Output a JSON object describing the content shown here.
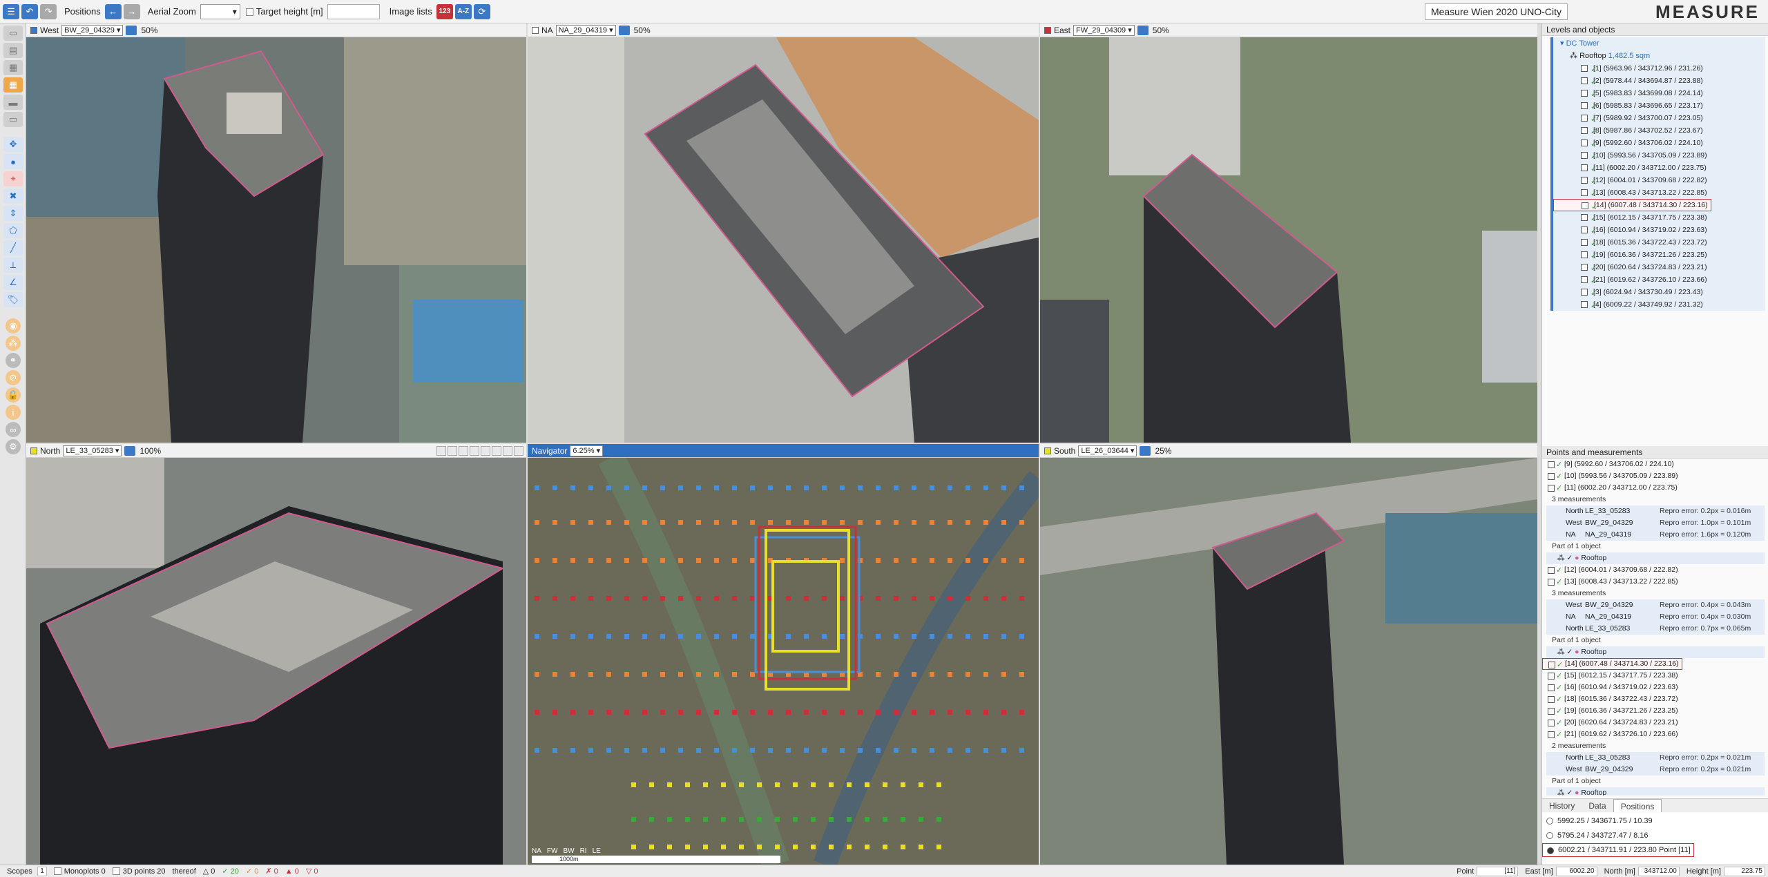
{
  "toolbar": {
    "positions_label": "Positions",
    "aerial_zoom_label": "Aerial Zoom",
    "target_height_label": "Target height [m]",
    "image_lists_label": "Image lists",
    "sort_numeric": "123",
    "sort_alpha": "A-Z",
    "app_title": "Measure Wien 2020 UNO-City",
    "brand": "MEASURE"
  },
  "views": {
    "west": {
      "label": "West",
      "image": "BW_29_04329",
      "zoom": "50%"
    },
    "na": {
      "label": "NA",
      "image": "NA_29_04319",
      "zoom": "50%"
    },
    "east": {
      "label": "East",
      "image": "FW_29_04309",
      "zoom": "50%"
    },
    "north": {
      "label": "North",
      "image": "LE_33_05283",
      "zoom": "100%"
    },
    "navigator": {
      "label": "Navigator",
      "zoom": "6.25%",
      "scale": "1000m",
      "legend": [
        "NA",
        "FW",
        "BW",
        "RI",
        "LE"
      ]
    },
    "south": {
      "label": "South",
      "image": "LE_26_03644",
      "zoom": "25%"
    }
  },
  "colors": {
    "accent": "#3b79c6",
    "selected": "#c8303a",
    "nav_orange": "#e8843a",
    "nav_blue": "#4a8fd6",
    "nav_red": "#c8303a",
    "nav_yellow": "#e6e02a",
    "nav_green": "#3aa83a"
  },
  "levels": {
    "title": "Levels and objects",
    "tower": "DC Tower",
    "rooftop": "Rooftop",
    "rooftop_area": "1,482.5 sqm",
    "points": [
      "[1] (5963.96 / 343712.96 / 231.26)",
      "[2] (5978.44 / 343694.87 / 223.88)",
      "[5] (5983.83 / 343699.08 / 224.14)",
      "[6] (5985.83 / 343696.65 / 223.17)",
      "[7] (5989.92 / 343700.07 / 223.05)",
      "[8] (5987.86 / 343702.52 / 223.67)",
      "[9] (5992.60 / 343706.02 / 224.10)",
      "[10] (5993.56 / 343705.09 / 223.89)",
      "[11] (6002.20 / 343712.00 / 223.75)",
      "[12] (6004.01 / 343709.68 / 222.82)",
      "[13] (6008.43 / 343713.22 / 222.85)",
      "[14] (6007.48 / 343714.30 / 223.16)",
      "[15] (6012.15 / 343717.75 / 223.38)",
      "[16] (6010.94 / 343719.02 / 223.63)",
      "[18] (6015.36 / 343722.43 / 223.72)",
      "[19] (6016.36 / 343721.26 / 223.25)",
      "[20] (6020.64 / 343724.83 / 223.21)",
      "[21] (6019.62 / 343726.10 / 223.66)",
      "[3] (6024.94 / 343730.49 / 223.43)",
      "[4] (6009.22 / 343749.92 / 231.32)"
    ]
  },
  "points_panel": {
    "title": "Points and measurements",
    "rows": [
      {
        "t": "pt",
        "text": "[9] (5992.60 / 343706.02 / 224.10)"
      },
      {
        "t": "pt",
        "text": "[10] (5993.56 / 343705.09 / 223.89)"
      },
      {
        "t": "pt",
        "text": "[11] (6002.20 / 343712.00 / 223.75)"
      },
      {
        "t": "hdr",
        "text": "3 measurements"
      },
      {
        "t": "m",
        "name": "North",
        "img": "LE_33_05283",
        "re": "Repro error: 0.2px = 0.016m"
      },
      {
        "t": "m",
        "name": "West",
        "img": "BW_29_04329",
        "re": "Repro error: 1.0px = 0.101m"
      },
      {
        "t": "m",
        "name": "NA",
        "img": "NA_29_04319",
        "re": "Repro error: 1.6px = 0.120m"
      },
      {
        "t": "hdr",
        "text": "Part of 1 object"
      },
      {
        "t": "o",
        "text": "Rooftop"
      },
      {
        "t": "pt",
        "text": "[12] (6004.01 / 343709.68 / 222.82)"
      },
      {
        "t": "pt",
        "text": "[13] (6008.43 / 343713.22 / 222.85)"
      },
      {
        "t": "hdr",
        "text": "3 measurements"
      },
      {
        "t": "m",
        "name": "West",
        "img": "BW_29_04329",
        "re": "Repro error: 0.4px = 0.043m"
      },
      {
        "t": "m",
        "name": "NA",
        "img": "NA_29_04319",
        "re": "Repro error: 0.4px = 0.030m"
      },
      {
        "t": "m",
        "name": "North",
        "img": "LE_33_05283",
        "re": "Repro error: 0.7px = 0.065m"
      },
      {
        "t": "hdr",
        "text": "Part of 1 object"
      },
      {
        "t": "o",
        "text": "Rooftop"
      },
      {
        "t": "pts",
        "text": "[14] (6007.48 / 343714.30 / 223.16)"
      },
      {
        "t": "pt",
        "text": "[15] (6012.15 / 343717.75 / 223.38)"
      },
      {
        "t": "pt",
        "text": "[16] (6010.94 / 343719.02 / 223.63)"
      },
      {
        "t": "pt",
        "text": "[18] (6015.36 / 343722.43 / 223.72)"
      },
      {
        "t": "pt",
        "text": "[19] (6016.36 / 343721.26 / 223.25)"
      },
      {
        "t": "pt",
        "text": "[20] (6020.64 / 343724.83 / 223.21)"
      },
      {
        "t": "pt",
        "text": "[21] (6019.62 / 343726.10 / 223.66)"
      },
      {
        "t": "hdr",
        "text": "2 measurements"
      },
      {
        "t": "m",
        "name": "North",
        "img": "LE_33_05283",
        "re": "Repro error: 0.2px = 0.021m"
      },
      {
        "t": "m",
        "name": "West",
        "img": "BW_29_04329",
        "re": "Repro error: 0.2px = 0.021m"
      },
      {
        "t": "hdr",
        "text": "Part of 1 object"
      },
      {
        "t": "o",
        "text": "Rooftop"
      }
    ]
  },
  "tabs": [
    "History",
    "Data",
    "Positions"
  ],
  "positions": [
    "5992.25 / 343671.75 / 10.39",
    "5795.24 / 343727.47 / 8.16",
    "6002.21 / 343711.91 / 223.80  Point [11]"
  ],
  "status": {
    "scopes": "Scopes",
    "scopes_n": "1",
    "monoplots": "Monoplots",
    "monoplots_n": "0",
    "points3d": "3D points",
    "points3d_n": "20",
    "thereof": "thereof",
    "c1": "0",
    "c2": "20",
    "c3": "0",
    "c4": "0",
    "c5": "0",
    "c6": "0",
    "point_label": "Point",
    "point_val": "[11]",
    "east_label": "East [m]",
    "east_val": "6002.20",
    "north_label": "North [m]",
    "north_val": "343712.00",
    "height_label": "Height [m]",
    "height_val": "223.75"
  }
}
